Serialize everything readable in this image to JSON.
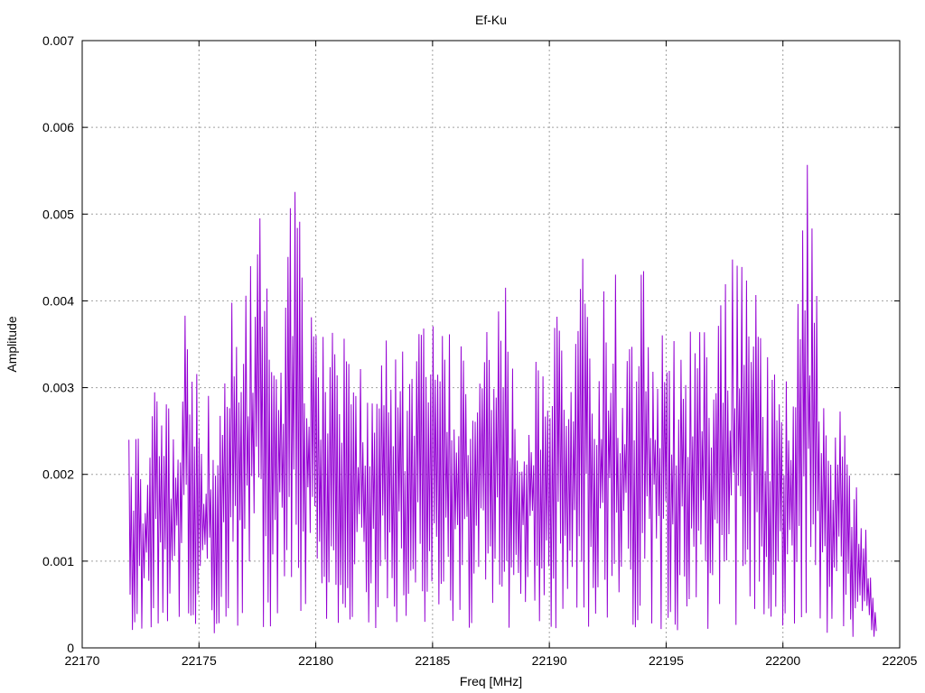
{
  "chart_data": {
    "type": "line",
    "title": "Ef-Ku",
    "xlabel": "Freq [MHz]",
    "ylabel": "Amplitude",
    "xlim": [
      22170,
      22205
    ],
    "ylim": [
      0,
      0.007
    ],
    "x_ticks": [
      "22170",
      "22175",
      "22180",
      "22185",
      "22190",
      "22195",
      "22200",
      "22205"
    ],
    "y_ticks": [
      "0",
      "0.001",
      "0.002",
      "0.003",
      "0.004",
      "0.005",
      "0.006",
      "0.007"
    ],
    "grid": true,
    "series": [
      {
        "color": "#9400d3",
        "x_start": 22172.0,
        "x_end": 22204.0,
        "points": 640,
        "envelope": [
          [
            22172.0,
            0.0031
          ],
          [
            22172.6,
            0.0024
          ],
          [
            22173.0,
            0.0037
          ],
          [
            22173.6,
            0.0031
          ],
          [
            22174.0,
            0.003
          ],
          [
            22174.5,
            0.0048
          ],
          [
            22175.0,
            0.003
          ],
          [
            22175.6,
            0.0029
          ],
          [
            22176.0,
            0.0038
          ],
          [
            22176.6,
            0.0043
          ],
          [
            22177.0,
            0.0047
          ],
          [
            22177.5,
            0.0054
          ],
          [
            22178.0,
            0.0042
          ],
          [
            22178.5,
            0.004
          ],
          [
            22179.0,
            0.0056
          ],
          [
            22179.6,
            0.0045
          ],
          [
            22180.0,
            0.0038
          ],
          [
            22180.6,
            0.0037
          ],
          [
            22181.0,
            0.0036
          ],
          [
            22181.6,
            0.0037
          ],
          [
            22182.0,
            0.0035
          ],
          [
            22182.6,
            0.0034
          ],
          [
            22183.0,
            0.0036
          ],
          [
            22183.6,
            0.0035
          ],
          [
            22184.0,
            0.0036
          ],
          [
            22184.6,
            0.0042
          ],
          [
            22185.0,
            0.004
          ],
          [
            22185.6,
            0.0036
          ],
          [
            22186.0,
            0.0037
          ],
          [
            22186.6,
            0.0035
          ],
          [
            22187.0,
            0.0037
          ],
          [
            22187.6,
            0.0036
          ],
          [
            22188.0,
            0.0043
          ],
          [
            22188.6,
            0.0037
          ],
          [
            22189.0,
            0.0035
          ],
          [
            22189.6,
            0.0036
          ],
          [
            22190.0,
            0.004
          ],
          [
            22190.6,
            0.0037
          ],
          [
            22191.0,
            0.0041
          ],
          [
            22191.6,
            0.0049
          ],
          [
            22192.0,
            0.0039
          ],
          [
            22192.6,
            0.0048
          ],
          [
            22193.0,
            0.004
          ],
          [
            22193.6,
            0.0042
          ],
          [
            22194.0,
            0.0046
          ],
          [
            22194.6,
            0.0042
          ],
          [
            22195.0,
            0.004
          ],
          [
            22195.6,
            0.0037
          ],
          [
            22196.0,
            0.0038
          ],
          [
            22196.6,
            0.004
          ],
          [
            22197.0,
            0.0038
          ],
          [
            22197.6,
            0.0045
          ],
          [
            22198.0,
            0.0046
          ],
          [
            22198.6,
            0.0049
          ],
          [
            22199.0,
            0.0036
          ],
          [
            22199.6,
            0.0034
          ],
          [
            22200.0,
            0.0032
          ],
          [
            22200.5,
            0.0034
          ],
          [
            22201.0,
            0.006
          ],
          [
            22201.6,
            0.0036
          ],
          [
            22202.0,
            0.003
          ],
          [
            22202.6,
            0.0029
          ],
          [
            22203.0,
            0.002
          ],
          [
            22203.6,
            0.0014
          ],
          [
            22204.0,
            0.0005
          ]
        ]
      }
    ]
  }
}
